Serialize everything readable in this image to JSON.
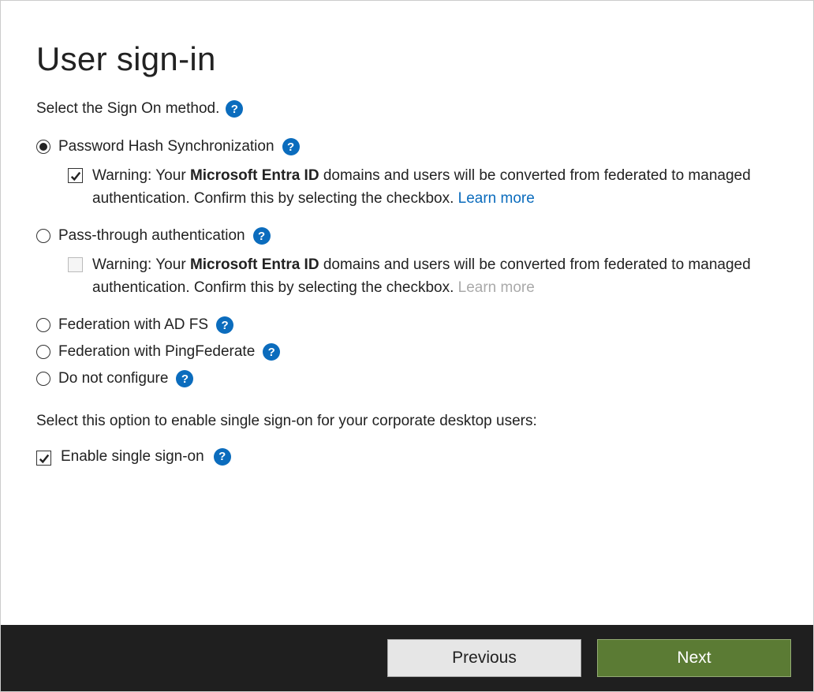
{
  "title": "User sign-in",
  "intro": "Select the Sign On method.",
  "options": {
    "phs": {
      "label": "Password Hash Synchronization",
      "warning_prefix": "Warning: Your ",
      "warning_bold": "Microsoft Entra ID",
      "warning_suffix": " domains and users will be converted from federated to managed authentication. Confirm this by selecting the checkbox. ",
      "learn_more": "Learn more"
    },
    "pta": {
      "label": "Pass-through authentication",
      "warning_prefix": "Warning: Your ",
      "warning_bold": "Microsoft Entra ID",
      "warning_suffix": " domains and users will be converted from federated to managed authentication. Confirm this by selecting the checkbox. ",
      "learn_more": "Learn more"
    },
    "adfs": {
      "label": "Federation with AD FS"
    },
    "ping": {
      "label": "Federation with PingFederate"
    },
    "none": {
      "label": "Do not configure"
    }
  },
  "sso_section": "Select this option to enable single sign-on for your corporate desktop users:",
  "sso_label": "Enable single sign-on",
  "buttons": {
    "previous": "Previous",
    "next": "Next"
  },
  "help_glyph": "?"
}
